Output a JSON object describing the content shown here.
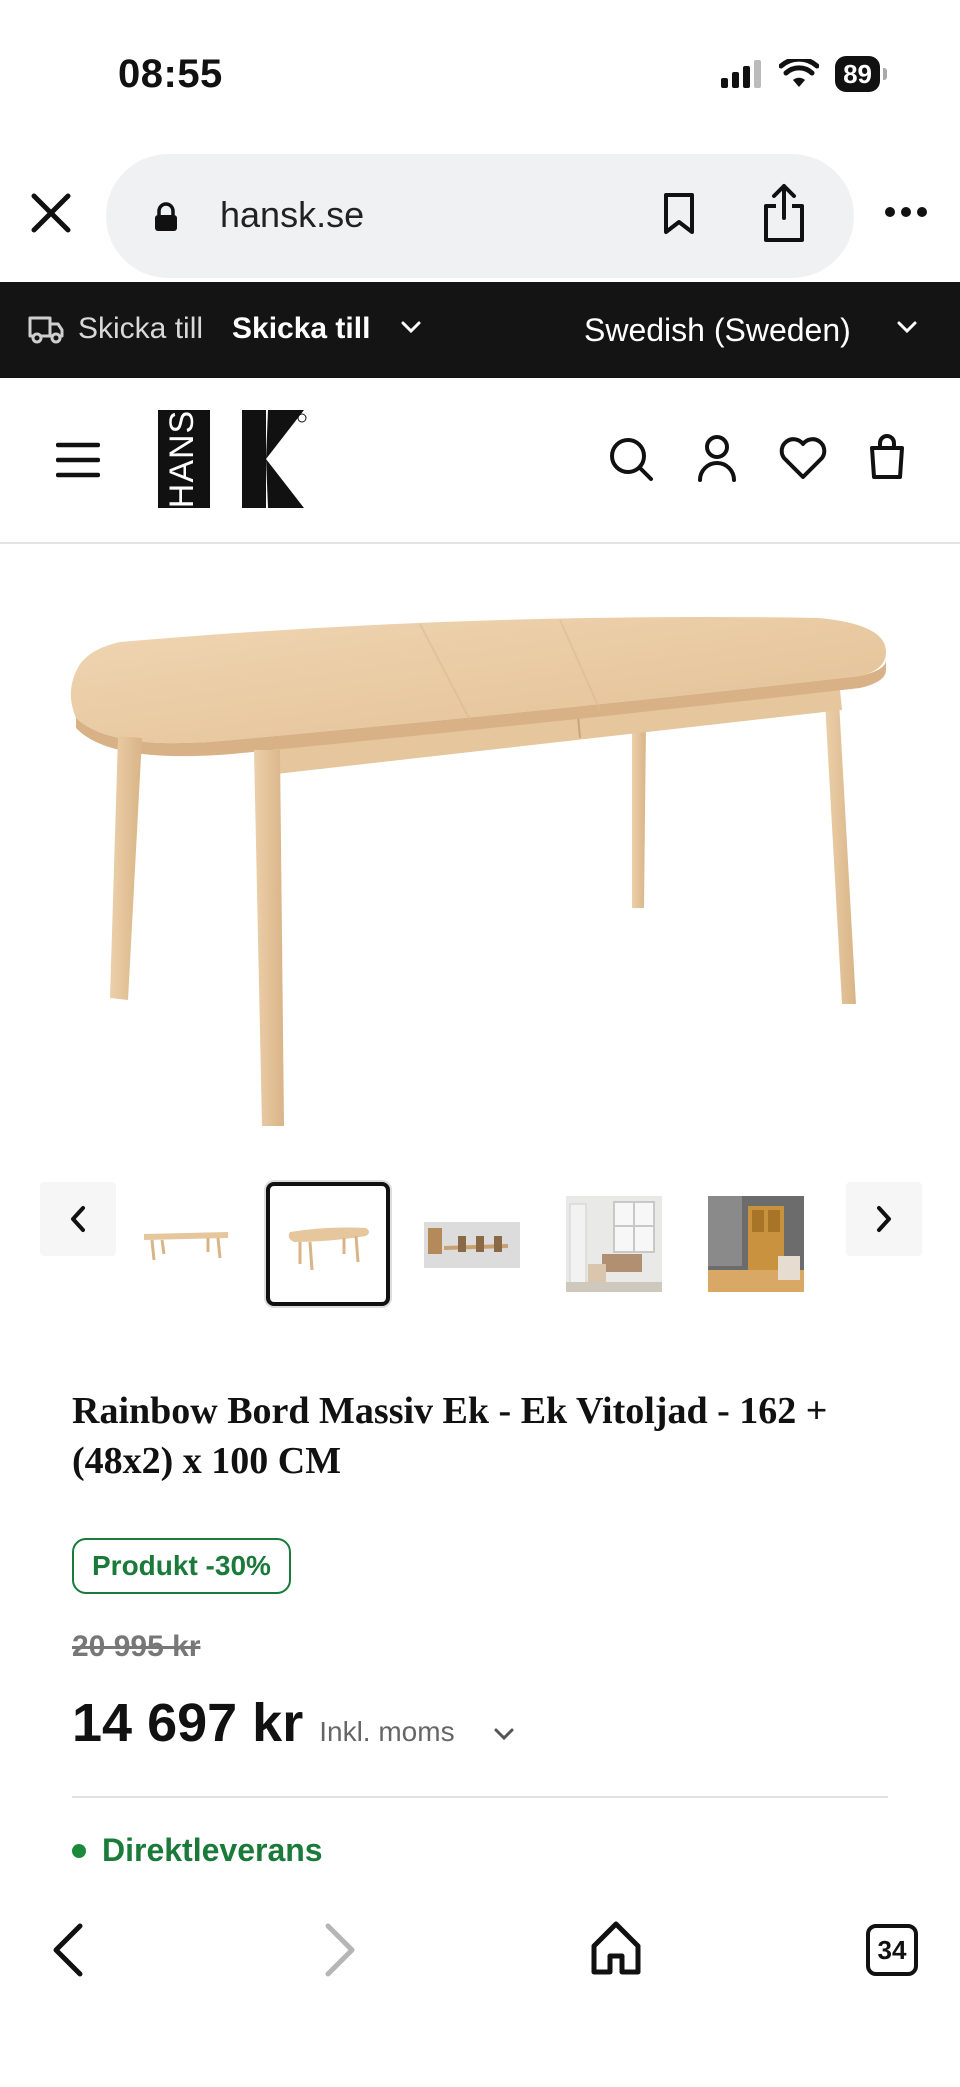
{
  "status": {
    "time": "08:55",
    "battery": "89"
  },
  "browser": {
    "url": "hansk.se",
    "tab_count": "34"
  },
  "ship_bar": {
    "label": "Skicka till",
    "value": "Skicka till",
    "language": "Swedish (Sweden)"
  },
  "logo": {
    "text": "HANS"
  },
  "product": {
    "title": "Rainbow Bord Massiv Ek - Ek Vitoljad - 162 + (48x2) x 100 CM",
    "badge": "Produkt -30%",
    "old_price": "20 995 kr",
    "price": "14 697 kr",
    "vat_label": "Inkl. moms",
    "delivery": "Direktleverans"
  },
  "thumbnails": {
    "count": 5,
    "selected_index": 1
  },
  "icons": {
    "close": "close-icon",
    "lock": "lock-icon",
    "bookmark": "bookmark-icon",
    "share": "share-icon",
    "more": "more-icon",
    "truck": "truck-icon",
    "menu": "menu-icon",
    "search": "search-icon",
    "account": "account-icon",
    "heart": "heart-icon",
    "cart": "shopping-bag-icon",
    "back": "back-arrow-icon",
    "forward": "forward-arrow-icon",
    "home": "home-icon"
  },
  "colors": {
    "accent_green": "#1a7a3a",
    "ship_bar_bg": "#141414",
    "wood": "#e9c9a0"
  }
}
